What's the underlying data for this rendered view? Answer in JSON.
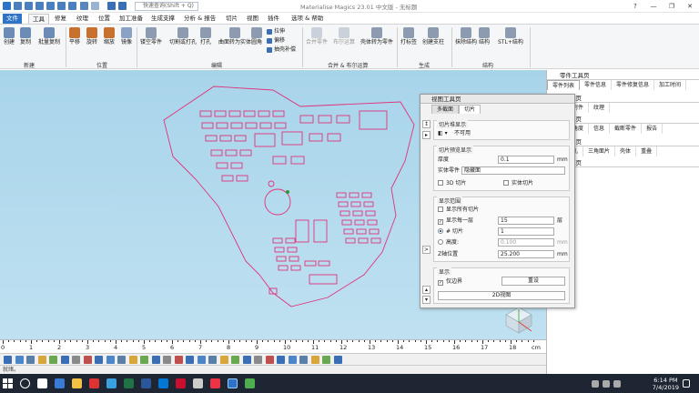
{
  "window": {
    "title": "Materialise Magics 23.01 中文版 - 无标题",
    "search_placeholder": "快速查询(Shift + Q)",
    "controls": [
      "?",
      "—",
      "❐",
      "✕"
    ]
  },
  "menu": {
    "tabs": [
      "文件",
      "工具",
      "修复",
      "纹理",
      "位置",
      "加工准备",
      "生成支撑",
      "分析 & 报告",
      "切片",
      "视图",
      "插件",
      "选项 & 帮助"
    ],
    "active_tab": "工具"
  },
  "ribbon": {
    "groups": [
      {
        "label": "新建",
        "buttons": [
          "创建",
          "复制",
          "批量复制"
        ]
      },
      {
        "label": "位置",
        "buttons": [
          "平移",
          "旋转",
          "缩放",
          "镜像"
        ]
      },
      {
        "label": "编辑",
        "buttons": [
          "镂空零件",
          "切割或打孔",
          "打孔",
          "曲面转为实体",
          "圆角"
        ],
        "small_buttons": [
          "拉伸",
          "偏移",
          "抽壳补偿"
        ]
      },
      {
        "label": "合并 & 布尔运算",
        "buttons": [
          "合并零件",
          "布尔运算",
          "壳体转为零件"
        ]
      },
      {
        "label": "生成",
        "buttons": [
          "打标签",
          "创建支柱"
        ]
      },
      {
        "label": "结构",
        "buttons": [
          "抹除结构",
          "结构",
          "STL+结构"
        ]
      }
    ]
  },
  "ruler": {
    "labels": [
      "0",
      "1",
      "2",
      "3",
      "4",
      "5",
      "6",
      "7",
      "8",
      "9",
      "10",
      "11",
      "12",
      "13",
      "14",
      "15",
      "16",
      "17",
      "18"
    ],
    "unit": "cm"
  },
  "status": {
    "text": "就绪。"
  },
  "right_pane": {
    "panel1_title": "零件工具页",
    "panel1_tabs": [
      "零件列表",
      "零件信息",
      "零件修复信息",
      "加工时间"
    ],
    "panel2_title": "C工具页",
    "panel2_tabs": [
      "视图",
      "附件",
      "纹理"
    ],
    "panel3_title": "C工具页",
    "panel3_tabs": [
      "图形",
      "角度",
      "信息",
      "截断零件",
      "报告"
    ],
    "panel4_title": "C工具页",
    "panel4_tabs": [
      "基本",
      "孔",
      "三角面片",
      "壳体",
      "重叠"
    ],
    "panel5_title": "C工具页"
  },
  "dialog": {
    "title": "视图工具页",
    "tabs": [
      "多截面",
      "切片"
    ],
    "active_tab": "切片",
    "section_slice_display": {
      "title": "切片堆显示",
      "value": "不可用"
    },
    "section_preview": {
      "title": "切片预览显示",
      "thickness_label": "厚度",
      "thickness_value": "0.1",
      "thickness_unit": "mm",
      "solid_parts_label": "实体零件",
      "solid_parts_value": "隐藏面",
      "check_3d": "3D 切片",
      "check_solid": "实体切片"
    },
    "section_range": {
      "title": "显示范围",
      "show_all": "显示所有切片",
      "show_every_label": "显示每一层",
      "show_every_value": "15",
      "show_every_unit": "层",
      "radio_slice_label": "# 切片",
      "radio_slice_value": "1",
      "radio_height_label": "高度:",
      "radio_height_value": "0.100",
      "radio_height_unit": "mm",
      "z_label": "Z轴位置",
      "z_value": "25.200",
      "z_unit": "mm"
    },
    "section_display": {
      "title": "显示",
      "contour_label": "仅边界",
      "reset_button": "重设",
      "view2d_button": "2D视图"
    }
  },
  "taskbar": {
    "time": "6:14 PM",
    "date": "7/4/2019"
  },
  "colors": {
    "accent": "#2e73c7",
    "viewport_top": "#a8d4ea",
    "slice_contour": "#e0337a",
    "taskbar": "#1f2633"
  }
}
